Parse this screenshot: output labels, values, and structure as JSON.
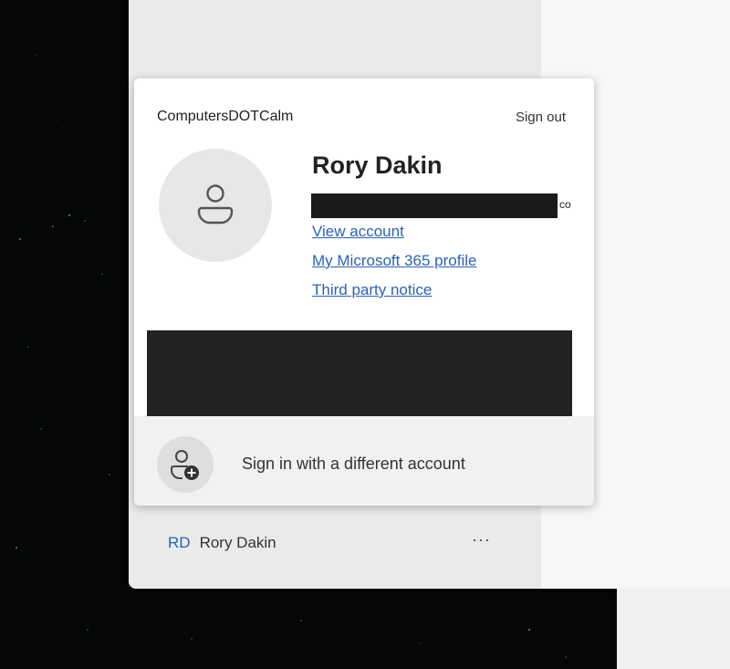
{
  "account_card": {
    "org_name": "ComputersDOTCalm",
    "sign_out_label": "Sign out",
    "user_name": "Rory Dakin",
    "email_suffix": "co",
    "links": {
      "view_account": "View account",
      "m365_profile": "My Microsoft 365 profile",
      "third_party_notice": "Third party notice"
    },
    "sign_in_different_label": "Sign in with a different account"
  },
  "account_list": {
    "initials": "RD",
    "name": "Rory Dakin",
    "more_label": "···"
  },
  "icons": {
    "avatar": "person-icon",
    "add_account": "person-add-icon",
    "more": "more-options-icon"
  },
  "colors": {
    "link": "#2b62b5",
    "card_background": "#ffffff",
    "footer_background": "#f1f1f1",
    "redaction": "#1b1b1b"
  }
}
